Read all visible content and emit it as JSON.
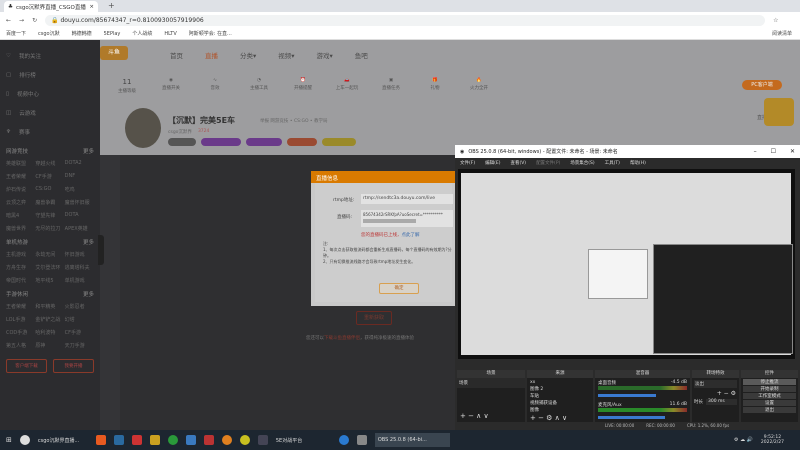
{
  "browser": {
    "tab_title": "csgo沉默界直播_CSGO直播",
    "url": "douyu.com/85674347_r=0.8100930057919906",
    "bookmarks": [
      "百度一下",
      "csgo沉默",
      "韩德韩德",
      "5EPlay",
      "个人战绩",
      "HLTV",
      "阿斯顿学会: 在直..."
    ],
    "bookmarks_right": "阅读清单"
  },
  "sidebar": {
    "items": [
      "我的关注",
      "排行榜",
      "视频中心",
      "云游戏",
      "赛事"
    ],
    "sections": [
      {
        "title": "网游竞技",
        "more": "更多",
        "items": [
          "英雄联盟",
          "穿越火线",
          "DOTA2",
          "王者荣耀",
          "CF手游",
          "DNF",
          "炉石传说",
          "CS:GO",
          "吃鸡",
          "云顶之弈",
          "魔兽争霸",
          "魔兽怀旧服",
          "暗黑4",
          "守望先锋",
          "DOTA",
          "魔兽世界",
          "无尽的拉刀",
          "APEX英雄"
        ]
      },
      {
        "title": "单机热游",
        "more": "更多",
        "items": [
          "主机游戏",
          "永劫无间",
          "怀旧游戏",
          "方舟生存",
          "艾尔登法环",
          "逃离塔科夫",
          "帝国时代",
          "地平线5",
          "单机游戏"
        ]
      },
      {
        "title": "手游休闲",
        "more": "更多",
        "items": [
          "王者荣耀",
          "和平精英",
          "火影忍者",
          "LOL手游",
          "金铲铲之战",
          "幻塔",
          "COD手游",
          "哈利波特",
          "CF手游",
          "第五人格",
          "原神",
          "天刀手游"
        ]
      }
    ],
    "download_button": "客户端下载",
    "live_button": "我要开播"
  },
  "header": {
    "nav": [
      "首页",
      "直播",
      "分类▾",
      "视频▾",
      "游戏▾",
      "鱼吧"
    ],
    "level_badge": "主播等级",
    "level": "11",
    "tools": [
      "主播等级",
      "直播开关",
      "音效",
      "主播工具",
      "开播提醒",
      "上车一起玩",
      "直播任务",
      "礼物",
      "火力全开"
    ],
    "room_title": "【沉默】完美5E车",
    "room_meta": "举报  网游竞技 • CS:GO • 教学局",
    "anchor": "csgo沉默界",
    "hot": "3724",
    "client_button": "PC客户端",
    "manage_button": "直播间管理"
  },
  "modal": {
    "title": "直播信息",
    "rtmp_label": "rtmp地址:",
    "rtmp_value": "rtmp://sendtc3a.douyu.com/live",
    "code_label": "直播码:",
    "code_value": "85674342rSRKfpA?uoSecret=**********",
    "warning": "您的直播码已上线，",
    "learn_more": "点此了解",
    "note_title": "注:",
    "note1": "1、每次点击获取推流码都会重新生成直播码，每个直播码的有效期为?分钟。",
    "note2": "2、只有切换推流线路才会导致rtmp地址发生变化。",
    "ok": "确定"
  },
  "main": {
    "refetch": "重新获取",
    "tip_pre": "您还可以",
    "tip_link": "下载斗鱼直播伴侣",
    "tip_post": "，获得纯净极速的直播体验"
  },
  "obs": {
    "title": "OBS 25.0.8 (64-bit, windows) - 配置文件: 未命名 - 场景: 未命名",
    "menu": [
      "文件(F)",
      "编辑(E)",
      "查看(V)",
      "配置文件(P)",
      "场景集合(S)",
      "工具(T)",
      "帮助(H)"
    ],
    "scenes_title": "场景",
    "scenes": [
      "场景"
    ],
    "sources_title": "来源",
    "sources": [
      "xx",
      "图像 2",
      "车贴",
      "视频捕获设备",
      "图像"
    ],
    "mixer_title": "混音器",
    "mixer": [
      {
        "name": "桌面音频",
        "db": "-4.5 dB"
      },
      {
        "name": "麦克风/Aux",
        "db": "11.6 dB"
      }
    ],
    "transitions_title": "转场特效",
    "transition": "淡出",
    "duration_label": "时长",
    "duration": "300 ms",
    "controls_title": "控件",
    "controls": [
      "停止推流",
      "开始录制",
      "工作室模式",
      "设置",
      "退出"
    ],
    "status": {
      "live": "LIVE: 00:00:00",
      "rec": "REC: 00:00:00",
      "cpu": "CPU: 1.2%, 60.00 fps"
    }
  },
  "taskbar": {
    "apps": [
      "csgo沉默界直播...",
      "5E对战平台",
      "OBS 25.0.8 (64-bi..."
    ],
    "time": "9:52:12",
    "date": "2022/2/27"
  }
}
